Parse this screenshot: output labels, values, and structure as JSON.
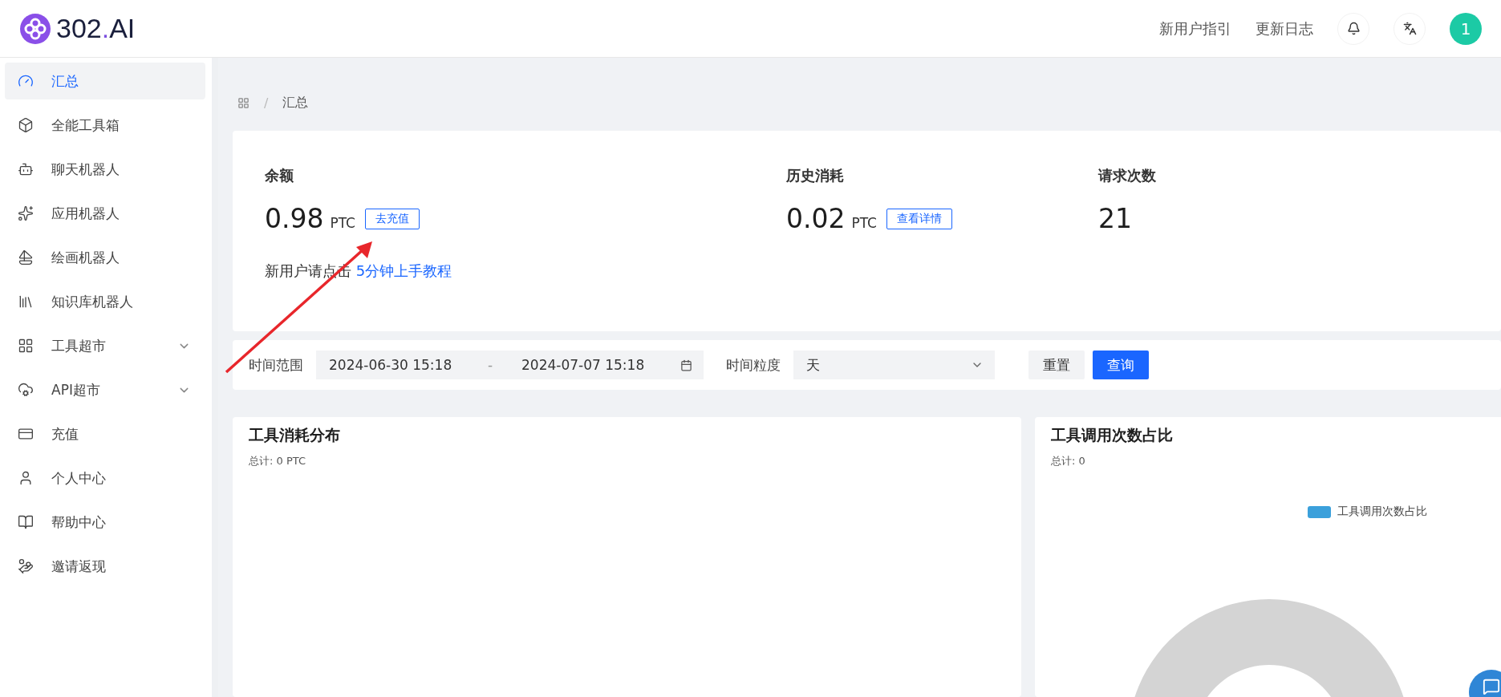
{
  "header": {
    "logo": {
      "prefix": "302",
      "dot": ".",
      "suffix": "AI"
    },
    "links": [
      "新用户指引",
      "更新日志"
    ],
    "avatar": "1"
  },
  "sidebar": {
    "items": [
      {
        "label": "汇总",
        "selected": true,
        "expandable": false
      },
      {
        "label": "全能工具箱",
        "selected": false,
        "expandable": false
      },
      {
        "label": "聊天机器人",
        "selected": false,
        "expandable": false
      },
      {
        "label": "应用机器人",
        "selected": false,
        "expandable": false
      },
      {
        "label": "绘画机器人",
        "selected": false,
        "expandable": false
      },
      {
        "label": "知识库机器人",
        "selected": false,
        "expandable": false
      },
      {
        "label": "工具超市",
        "selected": false,
        "expandable": true
      },
      {
        "label": "API超市",
        "selected": false,
        "expandable": true
      },
      {
        "label": "充值",
        "selected": false,
        "expandable": false
      },
      {
        "label": "个人中心",
        "selected": false,
        "expandable": false
      },
      {
        "label": "帮助中心",
        "selected": false,
        "expandable": false
      },
      {
        "label": "邀请返现",
        "selected": false,
        "expandable": false
      }
    ]
  },
  "breadcrumb": {
    "separator": "/",
    "current": "汇总"
  },
  "stats": [
    {
      "label": "余额",
      "value": "0.98",
      "unit": "PTC",
      "action": "去充值"
    },
    {
      "label": "历史消耗",
      "value": "0.02",
      "unit": "PTC",
      "action": "查看详情"
    },
    {
      "label": "请求次数",
      "value": "21"
    }
  ],
  "tutorial": {
    "text": "新用户请点击",
    "link": "5分钟上手教程"
  },
  "filter": {
    "range_label": "时间范围",
    "start": "2024-06-30 15:18",
    "separator": "-",
    "end": "2024-07-07 15:18",
    "granularity_label": "时间粒度",
    "granularity": "天",
    "reset": "重置",
    "query": "查询"
  },
  "charts": [
    {
      "title": "工具消耗分布",
      "total": "总计: 0 PTC"
    },
    {
      "title": "工具调用次数占比",
      "total": "总计: 0",
      "legend": {
        "label": "工具调用次数占比",
        "color": "#3ba0db"
      }
    }
  ]
}
